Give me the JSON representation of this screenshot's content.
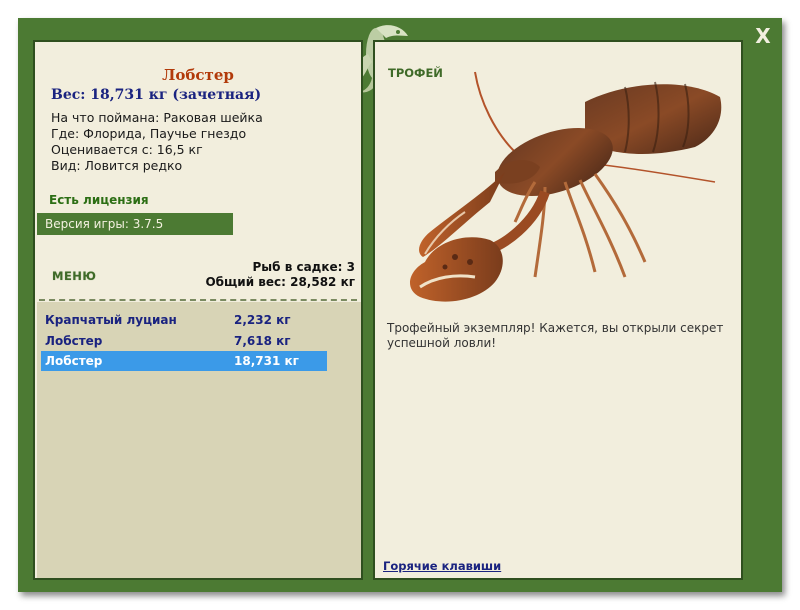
{
  "window": {
    "close_label": "X"
  },
  "fish": {
    "name": "Лобстер",
    "weight_line": "Вес: 18,731 кг (зачетная)",
    "bait": "На что поймана: Раковая шейка",
    "location": "Где: Флорида, Паучье гнездо",
    "scoring": "Оценивается с: 16,5 кг",
    "rarity": "Вид: Ловится редко"
  },
  "license": "Есть лицензия",
  "version": "Версия игры: 3.7.5",
  "menu_label": "МЕНЮ",
  "cage": {
    "count": "Рыб в садке: 3",
    "total_weight": "Общий вес: 28,582 кг"
  },
  "catch_list": [
    {
      "name": "Крапчатый луциан",
      "weight": "2,232 кг",
      "selected": false
    },
    {
      "name": "Лобстер",
      "weight": "7,618 кг",
      "selected": false
    },
    {
      "name": "Лобстер",
      "weight": "18,731 кг",
      "selected": true
    }
  ],
  "trophy": {
    "title": "ТРОФЕЙ",
    "description": "Трофейный экземпляр! Кажется, вы открыли секрет успешной ловли!"
  },
  "hotkeys_link": "Горячие клавиши",
  "colors": {
    "frame_green": "#4c7a33",
    "panel_bg": "#f2eedd",
    "list_bg": "#d8d4b6",
    "selected_row": "#3b9ae8",
    "fish_name": "#b23a0a",
    "text_blue": "#1a2380"
  },
  "icons": {
    "close": "close-icon",
    "mascot": "lizard-logo-icon"
  }
}
